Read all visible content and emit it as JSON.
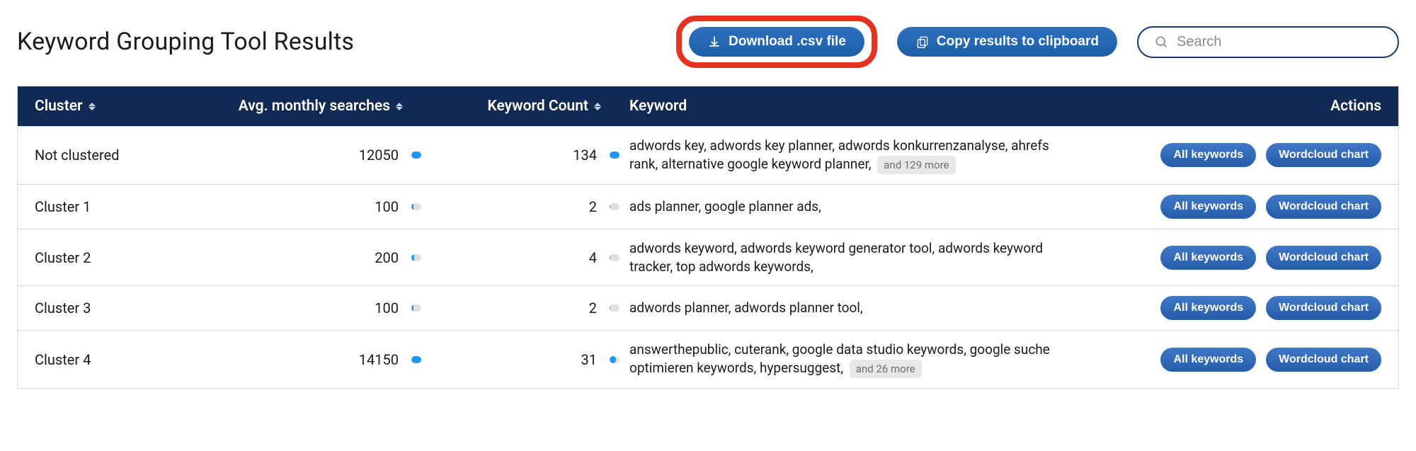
{
  "page_title": "Keyword Grouping Tool Results",
  "buttons": {
    "download_csv": "Download .csv file",
    "copy_clipboard": "Copy results to clipboard"
  },
  "search": {
    "placeholder": "Search",
    "value": ""
  },
  "columns": {
    "cluster": "Cluster",
    "avg_searches": "Avg. monthly searches",
    "keyword_count": "Keyword Count",
    "keyword": "Keyword",
    "actions": "Actions"
  },
  "action_labels": {
    "all_keywords": "All keywords",
    "wordcloud_chart": "Wordcloud chart"
  },
  "rows": [
    {
      "cluster": "Not clustered",
      "avg_searches": 12050,
      "avg_bar_pct": 100,
      "keyword_count": 134,
      "count_bar_pct": 100,
      "keywords": "adwords key, adwords key planner, adwords konkurrenzanalyse, ahrefs rank, alternative google keyword planner, ",
      "more": "and 129 more"
    },
    {
      "cluster": "Cluster 1",
      "avg_searches": 100,
      "avg_bar_pct": 22,
      "keyword_count": 2,
      "count_bar_pct": 6,
      "keywords": "ads planner, google planner ads,",
      "more": null
    },
    {
      "cluster": "Cluster 2",
      "avg_searches": 200,
      "avg_bar_pct": 28,
      "keyword_count": 4,
      "count_bar_pct": 10,
      "keywords": "adwords keyword, adwords keyword generator tool, adwords keyword tracker, top adwords keywords,",
      "more": null
    },
    {
      "cluster": "Cluster 3",
      "avg_searches": 100,
      "avg_bar_pct": 22,
      "keyword_count": 2,
      "count_bar_pct": 6,
      "keywords": "adwords planner, adwords planner tool,",
      "more": null
    },
    {
      "cluster": "Cluster 4",
      "avg_searches": 14150,
      "avg_bar_pct": 100,
      "keyword_count": 31,
      "count_bar_pct": 62,
      "keywords": "answerthepublic, cuterank, google data studio keywords, google suche optimieren keywords, hypersuggest, ",
      "more": "and 26 more"
    }
  ]
}
